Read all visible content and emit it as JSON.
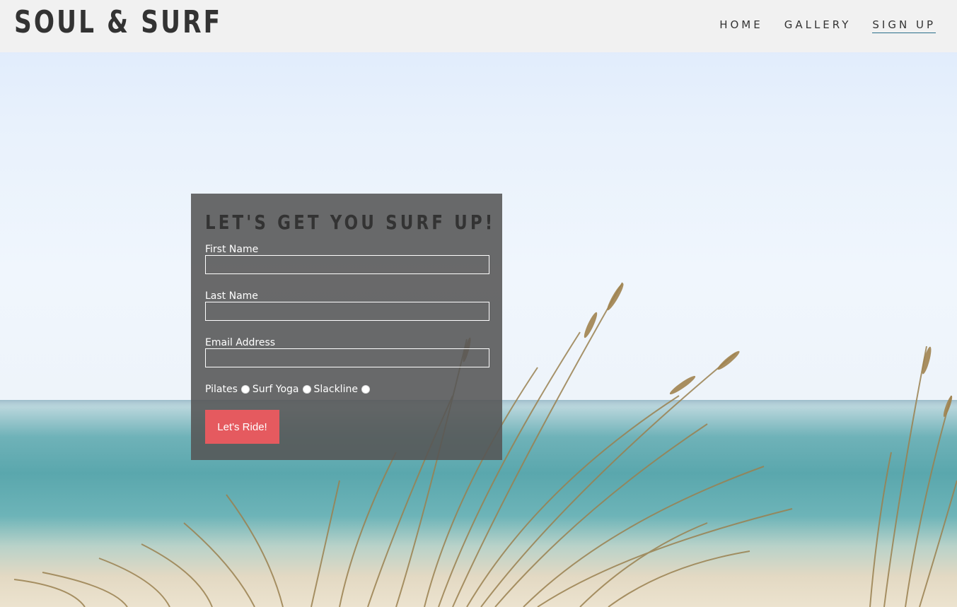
{
  "site": {
    "logo": "SOUL & SURF"
  },
  "nav": {
    "items": [
      {
        "label": "HOME",
        "active": false
      },
      {
        "label": "GALLERY",
        "active": false
      },
      {
        "label": "SIGN UP",
        "active": true
      }
    ]
  },
  "form": {
    "heading": "LET'S GET YOU SURF UP!",
    "first_name_label": "First Name",
    "first_name_value": "",
    "last_name_label": "Last Name",
    "last_name_value": "",
    "email_label": "Email Address",
    "email_value": "",
    "options": [
      "Pilates",
      "Surf Yoga",
      "Slackline"
    ],
    "submit_label": "Let's Ride!"
  },
  "colors": {
    "header_bg": "#f1f1f1",
    "panel_bg": "#555555",
    "button": "#e55a5f",
    "nav_active_underline": "#2a6f8a"
  }
}
